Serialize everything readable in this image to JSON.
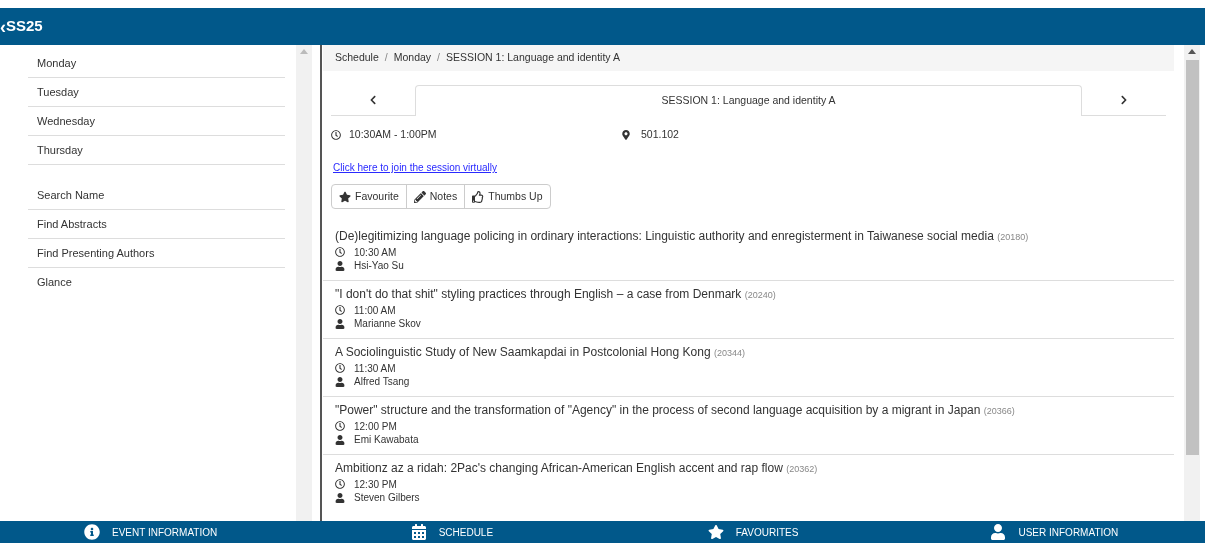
{
  "header": {
    "back": "‹",
    "title": "SS25"
  },
  "sidebar": {
    "days": [
      "Monday",
      "Tuesday",
      "Wednesday",
      "Thursday"
    ],
    "tools": [
      "Search Name",
      "Find Abstracts",
      "Find Presenting Authors",
      "Glance"
    ]
  },
  "breadcrumb": [
    {
      "label": "Schedule"
    },
    {
      "separator": "/",
      "label": "Monday"
    },
    {
      "separator": "/",
      "label": "SESSION 1: Language and identity A"
    }
  ],
  "session": {
    "title": "SESSION 1: Language and identity A",
    "time": "10:30AM - 1:00PM",
    "room": "501.102",
    "link": "Click here to join the session virtually"
  },
  "actions": [
    {
      "kind": "star",
      "label": "Favourite"
    },
    {
      "kind": "pencil",
      "label": "Notes"
    },
    {
      "kind": "thumb",
      "label": "Thumbs Up"
    }
  ],
  "talks": [
    {
      "title": "(De)legitimizing language policing in ordinary interactions: Linguistic authority and enregisterment in Taiwanese social media",
      "id": "(20180)",
      "time": "10:30 AM",
      "author": "Hsi-Yao Su"
    },
    {
      "title": "\"I don't do that shit\" styling practices through English – a case from Denmark",
      "id": "(20240)",
      "time": "11:00 AM",
      "author": "Marianne Skov"
    },
    {
      "title": "A Sociolinguistic Study of New Saamkapdai in Postcolonial Hong Kong",
      "id": "(20344)",
      "time": "11:30 AM",
      "author": "Alfred Tsang"
    },
    {
      "title": "\"Power\" structure and the transformation of \"Agency\" in the process of second language acquisition by a migrant in Japan",
      "id": "(20366)",
      "time": "12:00 PM",
      "author": "Emi Kawabata"
    },
    {
      "title": "Ambitionz az a ridah: 2Pac's changing African-American English accent and rap flow",
      "id": "(20362)",
      "time": "12:30 PM",
      "author": "Steven Gilbers"
    }
  ],
  "nav": [
    {
      "kind": "info",
      "label": "EVENT INFORMATION"
    },
    {
      "kind": "calendar",
      "label": "SCHEDULE"
    },
    {
      "kind": "star",
      "label": "FAVOURITES"
    },
    {
      "kind": "user",
      "label": "USER INFORMATION"
    }
  ]
}
